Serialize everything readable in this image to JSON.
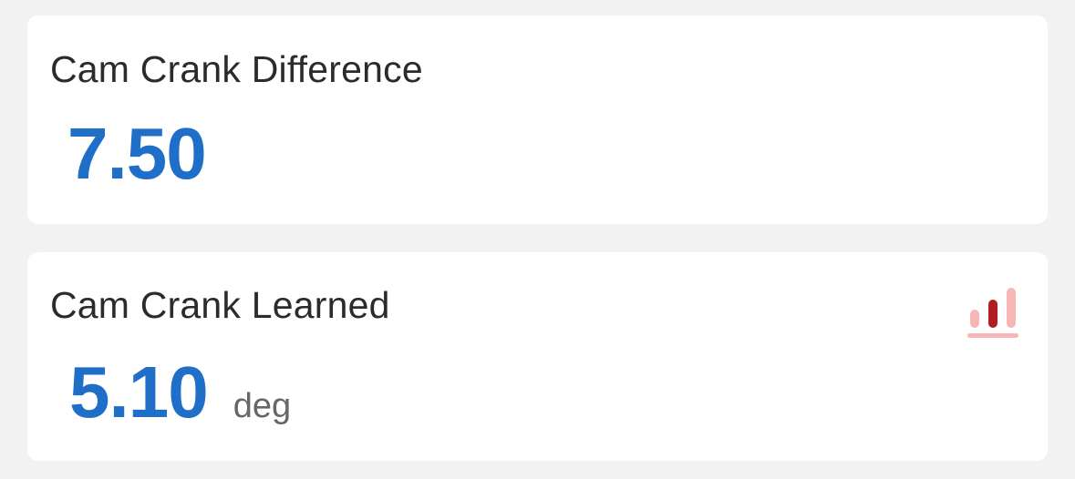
{
  "cards": [
    {
      "title": "Cam Crank Difference",
      "value": "7.50",
      "unit": ""
    },
    {
      "title": "Cam Crank Learned",
      "value": "5.10",
      "unit": "deg",
      "action_icon": "bar-chart-icon"
    }
  ],
  "colors": {
    "background": "#f2f2f2",
    "card": "#ffffff",
    "title_text": "#2b2b2b",
    "value_accent": "#1f6fc8",
    "unit_text": "#666666",
    "chart_icon_light": "#f7b5b5",
    "chart_icon_dark": "#b01e23"
  }
}
